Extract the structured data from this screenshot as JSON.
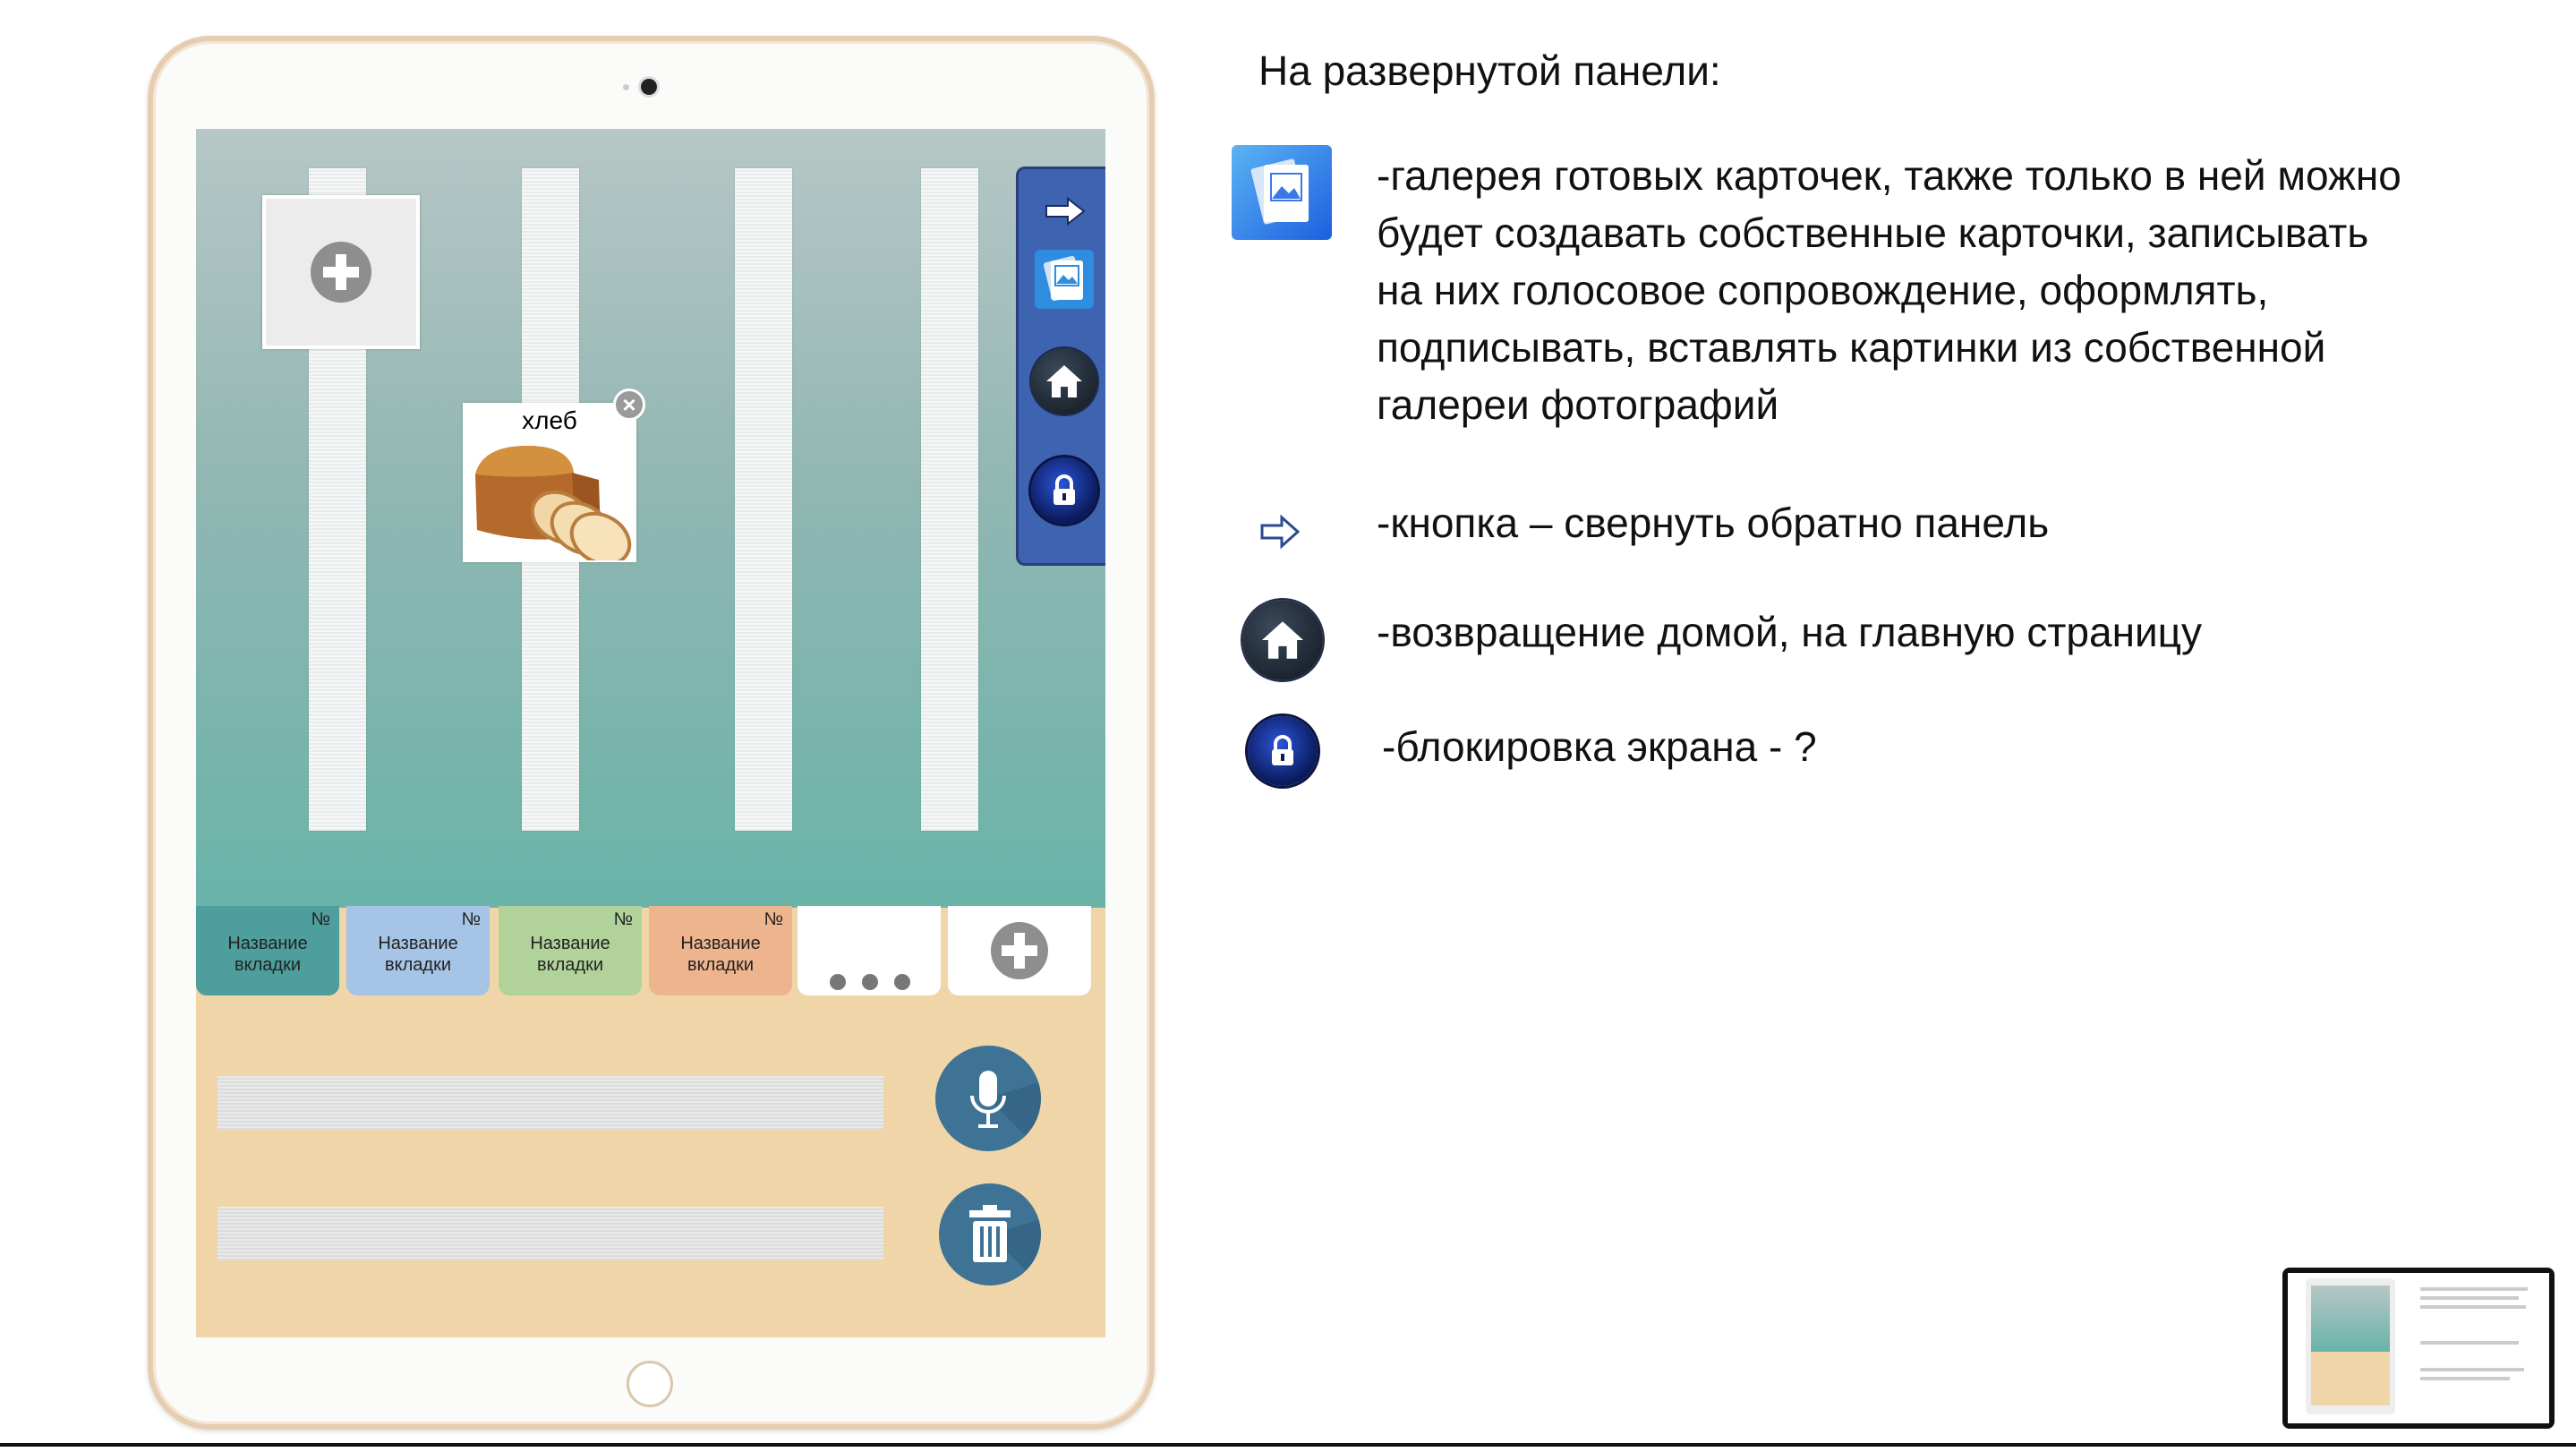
{
  "app": {
    "heading": "На развернутой панели:",
    "card": {
      "label": "хлеб"
    },
    "tabs": [
      {
        "num": "№",
        "name_line1": "Название",
        "name_line2": "вкладки",
        "color": "#4f9e9e"
      },
      {
        "num": "№",
        "name_line1": "Название",
        "name_line2": "вкладки",
        "color": "#a6c4e6"
      },
      {
        "num": "№",
        "name_line1": "Название",
        "name_line2": "вкладки",
        "color": "#b1d39a"
      },
      {
        "num": "№",
        "name_line1": "Название",
        "name_line2": "вкладки",
        "color": "#eeb48d"
      }
    ],
    "side_panel": {
      "icons": [
        "arrow-right-icon",
        "gallery-icon",
        "home-icon",
        "lock-icon"
      ]
    }
  },
  "legend": [
    {
      "icon": "gallery-icon",
      "lines": [
        "-галерея готовых карточек, также только в ней можно",
        "будет создавать собственные карточки, записывать",
        "на них голосовое сопровождение, оформлять,",
        "подписывать, вставлять картинки из собственной",
        "галереи фотографий"
      ]
    },
    {
      "icon": "arrow-right-icon",
      "lines": [
        "-кнопка – свернуть обратно панель"
      ]
    },
    {
      "icon": "home-icon",
      "lines": [
        "-возвращение домой, на главную страницу"
      ]
    },
    {
      "icon": "lock-icon",
      "lines": [
        "-блокировка экрана - ?"
      ]
    }
  ],
  "colors": {
    "panel": "#3e63b0",
    "bottom_area": "#efd5a8",
    "round_button": "#3f7395"
  }
}
